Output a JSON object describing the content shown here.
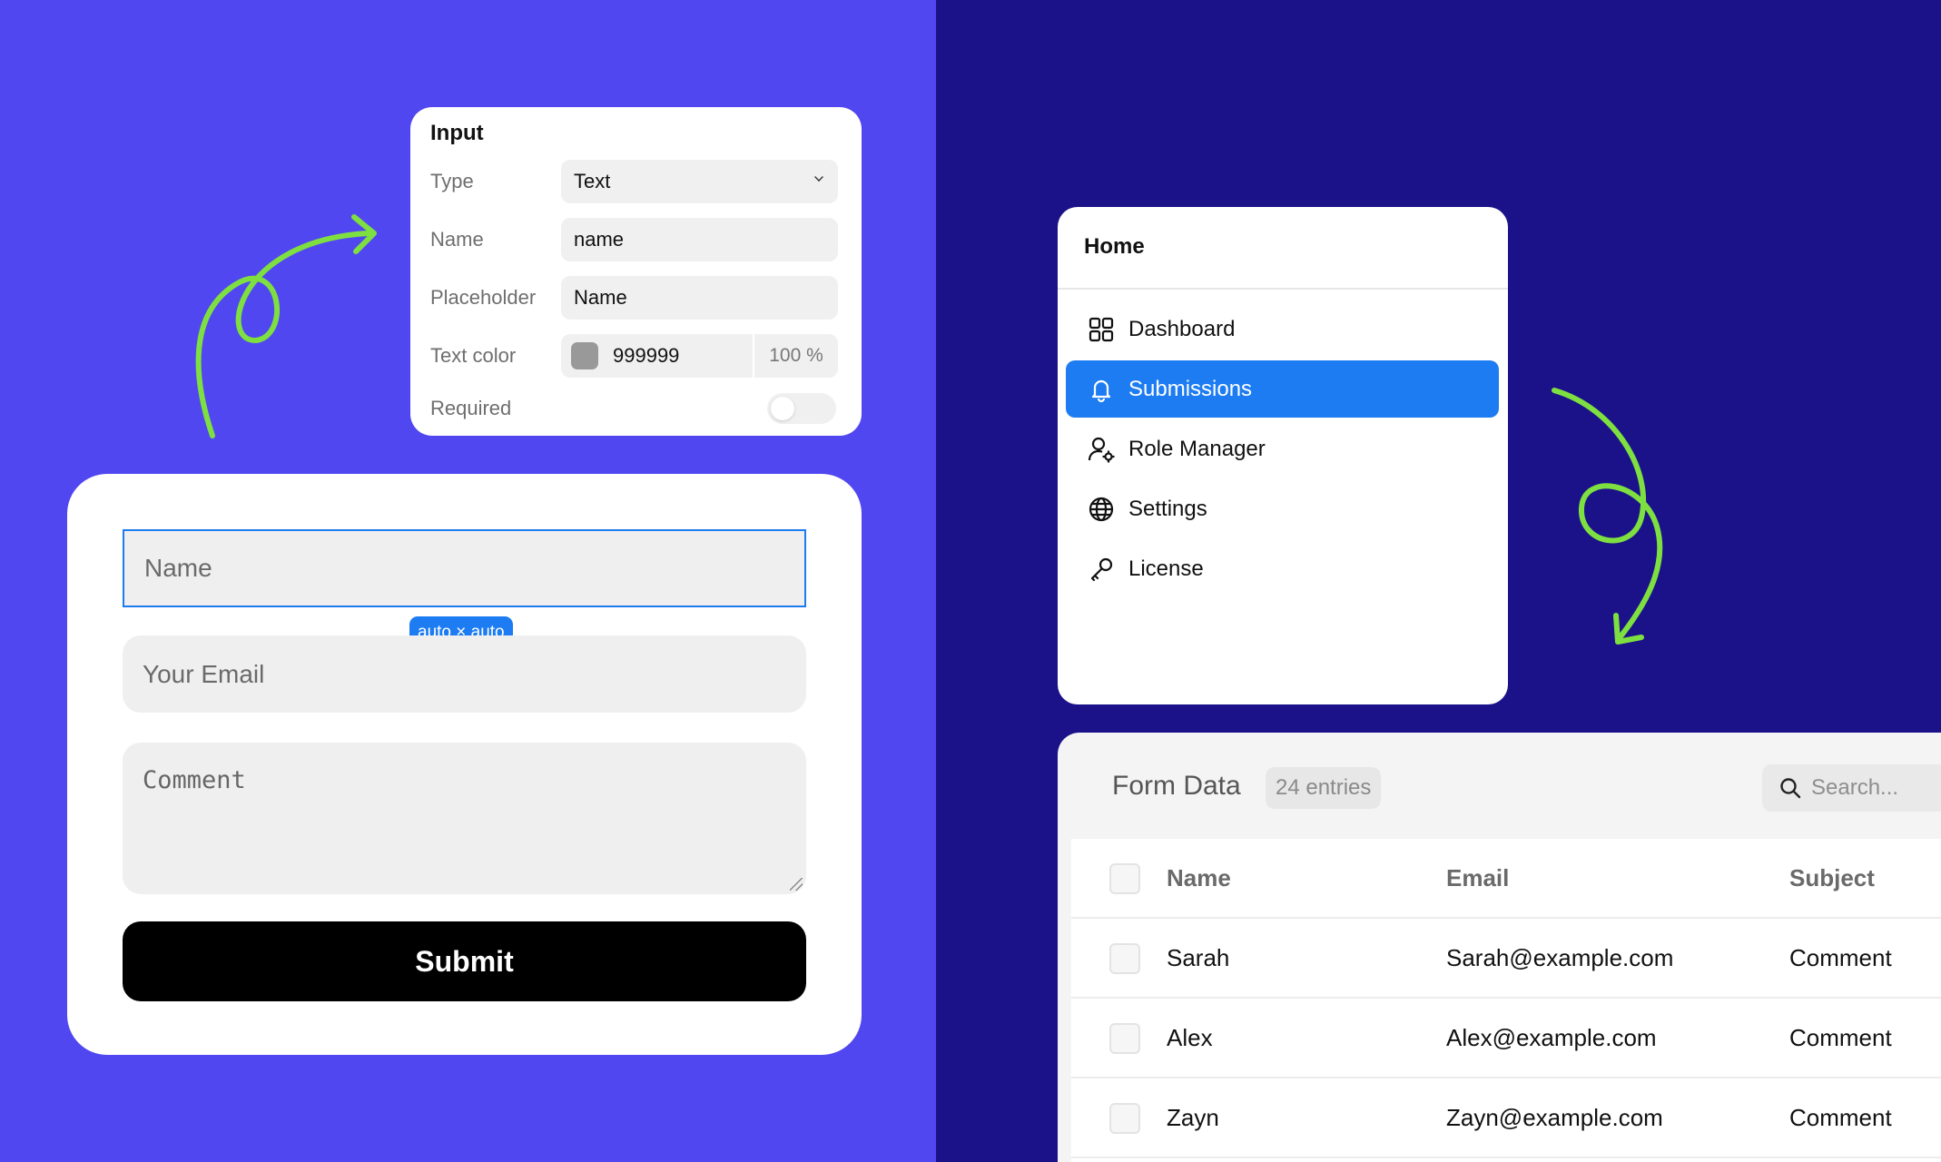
{
  "colors": {
    "left_bg": "#5147f0",
    "right_bg": "#1b128a",
    "accent": "#1d7cf2",
    "arrow": "#7ee040",
    "swatch": "#999999"
  },
  "input_panel": {
    "title": "Input",
    "rows": [
      {
        "label": "Type",
        "value": "Text"
      },
      {
        "label": "Name",
        "value": "name"
      },
      {
        "label": "Placeholder",
        "value": "Name"
      },
      {
        "label": "Text color",
        "value": "999999",
        "opacity": "100 %"
      },
      {
        "label": "Required",
        "value": false
      }
    ]
  },
  "form": {
    "name_placeholder": "Name",
    "email_placeholder": "Your Email",
    "comment_placeholder": "Comment",
    "size_badge": "auto × auto",
    "submit_label": "Submit"
  },
  "sidebar": {
    "title": "Home",
    "items": [
      {
        "label": "Dashboard",
        "icon": "grid-icon",
        "active": false
      },
      {
        "label": "Submissions",
        "icon": "bell-icon",
        "active": true
      },
      {
        "label": "Role Manager",
        "icon": "user-gear-icon",
        "active": false
      },
      {
        "label": "Settings",
        "icon": "globe-icon",
        "active": false
      },
      {
        "label": "License",
        "icon": "key-icon",
        "active": false
      }
    ]
  },
  "table": {
    "title": "Form Data",
    "count": "24 entries",
    "search_placeholder": "Search...",
    "columns": [
      "Name",
      "Email",
      "Subject"
    ],
    "rows": [
      [
        "Sarah",
        "Sarah@example.com",
        "Comment"
      ],
      [
        "Alex",
        "Alex@example.com",
        "Comment"
      ],
      [
        "Zayn",
        "Zayn@example.com",
        "Comment"
      ]
    ]
  }
}
